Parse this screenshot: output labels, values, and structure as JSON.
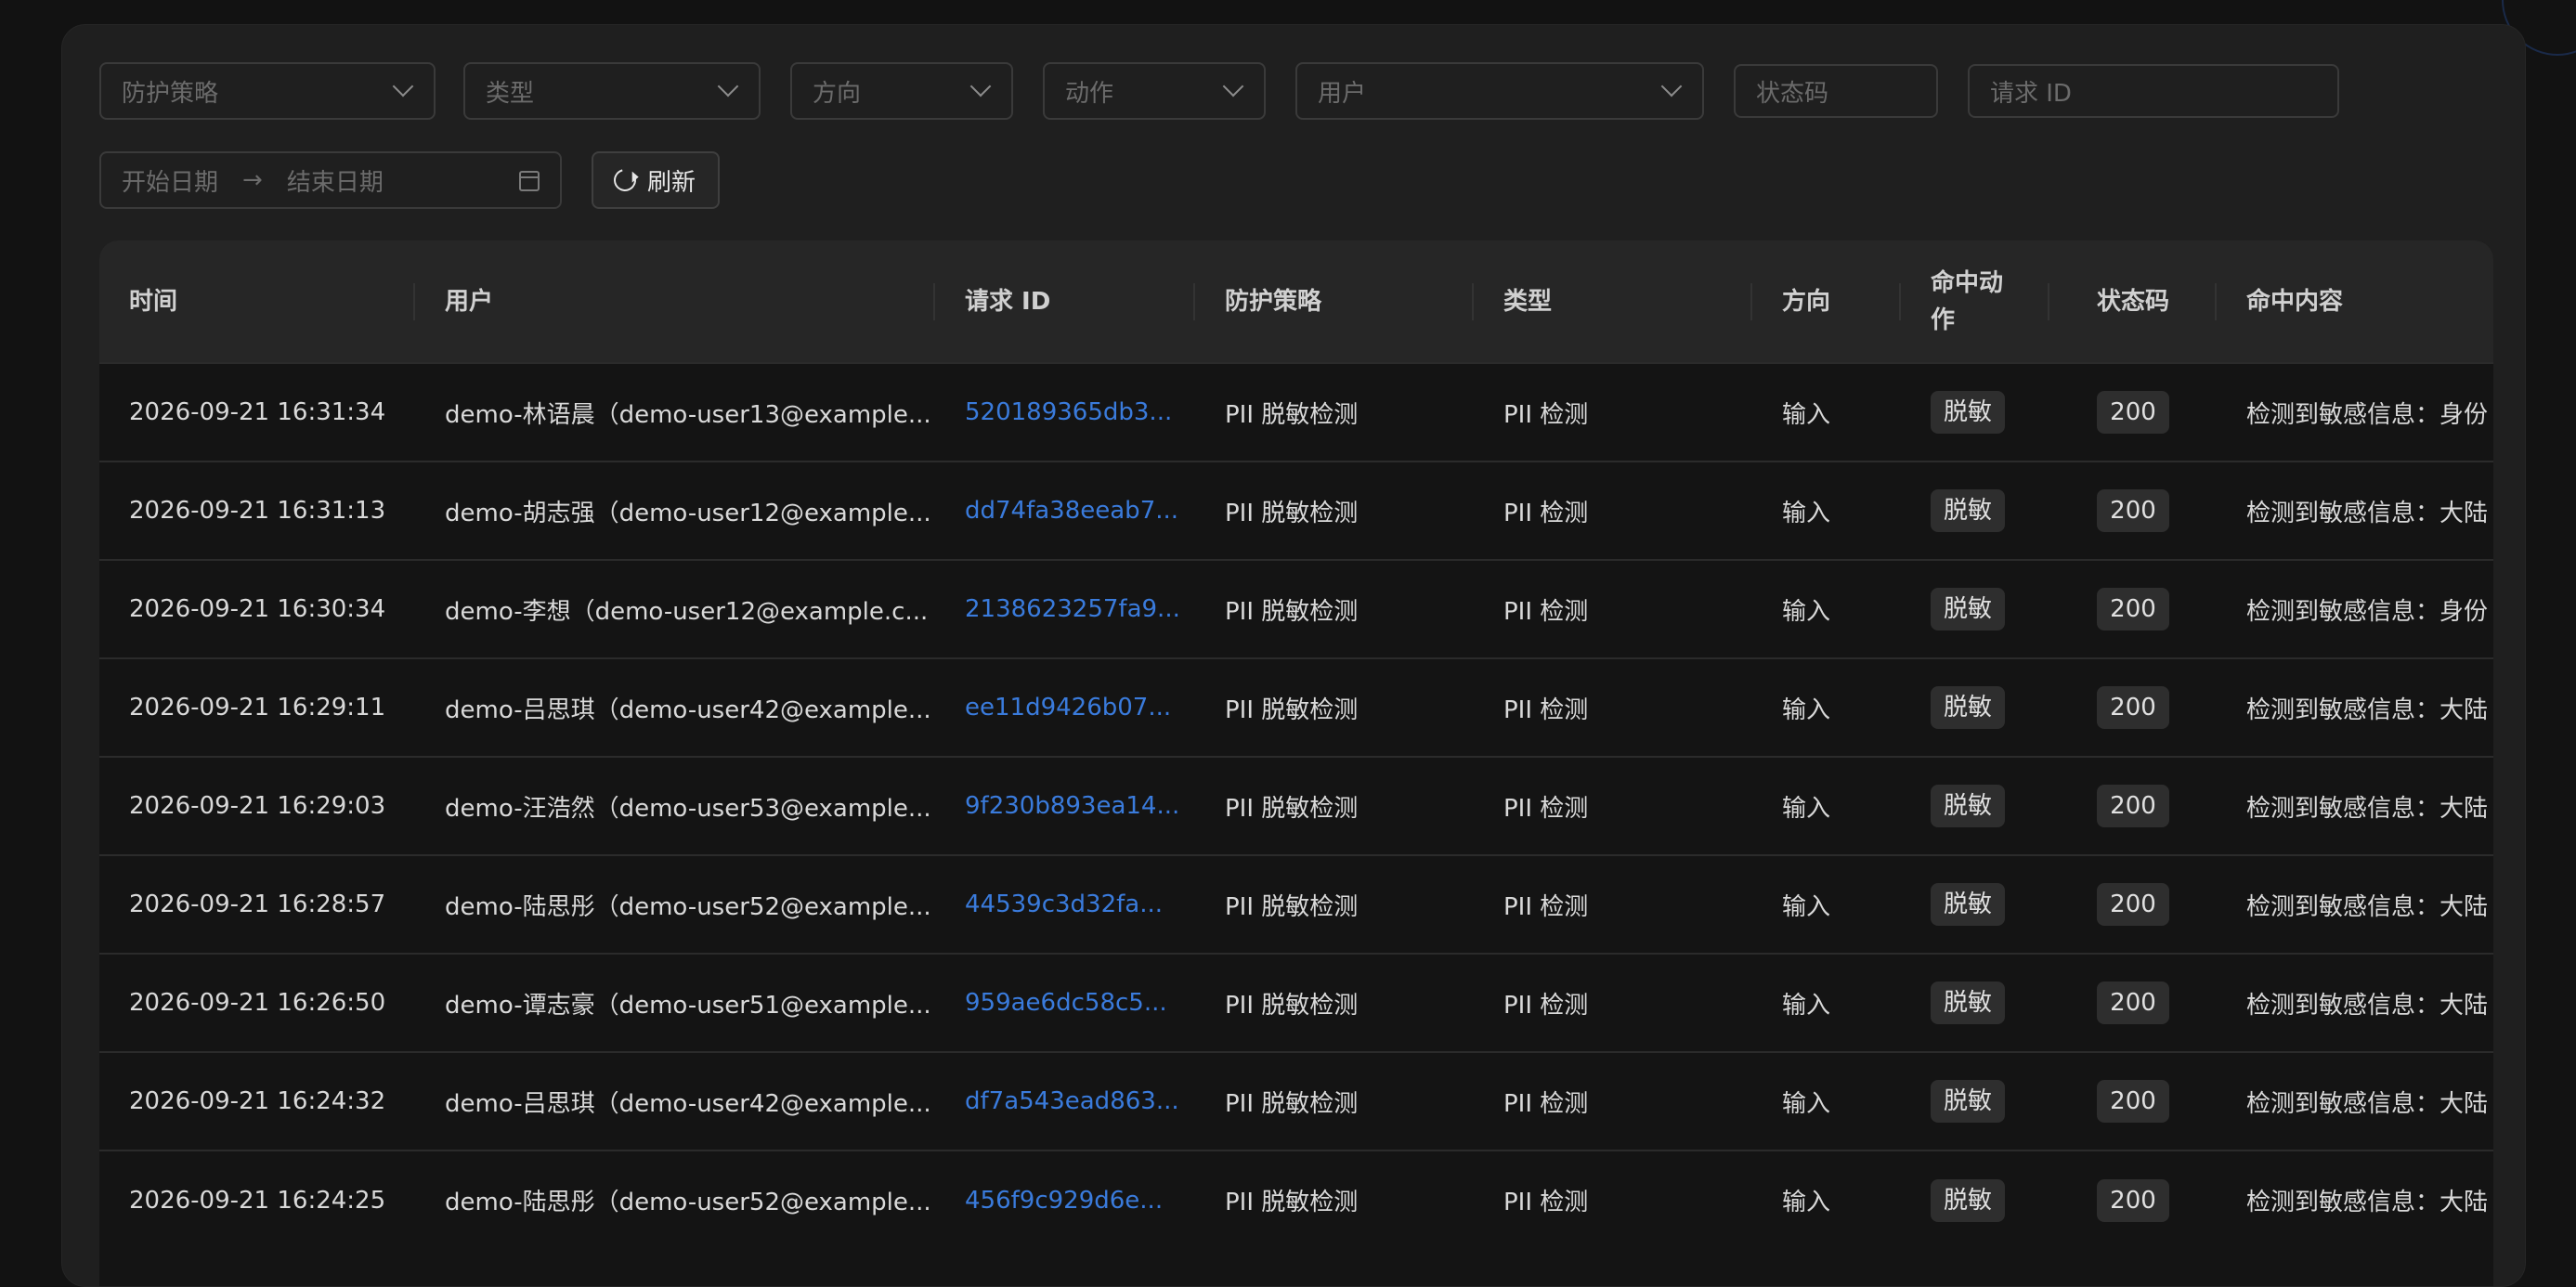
{
  "filters": {
    "policy": "防护策略",
    "type": "类型",
    "direction": "方向",
    "action": "动作",
    "user": "用户",
    "status_code": "状态码",
    "request_id": "请求 ID",
    "start_date": "开始日期",
    "end_date": "结束日期",
    "refresh": "刷新"
  },
  "table": {
    "headers": [
      "时间",
      "用户",
      "请求 ID",
      "防护策略",
      "类型",
      "方向",
      "命中动作",
      "状态码",
      "命中内容"
    ],
    "rows": [
      {
        "time": "2026-09-21 16:31:34",
        "user": "demo-林语晨（demo-user13@example...",
        "req": "520189365db3...",
        "policy": "PII 脱敏检测",
        "type": "PII 检测",
        "dir": "输入",
        "action": "脱敏",
        "code": "200",
        "content": "检测到敏感信息：身份"
      },
      {
        "time": "2026-09-21 16:31:13",
        "user": "demo-胡志强（demo-user12@example...",
        "req": "dd74fa38eeab7...",
        "policy": "PII 脱敏检测",
        "type": "PII 检测",
        "dir": "输入",
        "action": "脱敏",
        "code": "200",
        "content": "检测到敏感信息：大陆"
      },
      {
        "time": "2026-09-21 16:30:34",
        "user": "demo-李想（demo-user12@example.c...",
        "req": "2138623257fa9...",
        "policy": "PII 脱敏检测",
        "type": "PII 检测",
        "dir": "输入",
        "action": "脱敏",
        "code": "200",
        "content": "检测到敏感信息：身份"
      },
      {
        "time": "2026-09-21 16:29:11",
        "user": "demo-吕思琪（demo-user42@example...",
        "req": "ee11d9426b07...",
        "policy": "PII 脱敏检测",
        "type": "PII 检测",
        "dir": "输入",
        "action": "脱敏",
        "code": "200",
        "content": "检测到敏感信息：大陆"
      },
      {
        "time": "2026-09-21 16:29:03",
        "user": "demo-汪浩然（demo-user53@example...",
        "req": "9f230b893ea14...",
        "policy": "PII 脱敏检测",
        "type": "PII 检测",
        "dir": "输入",
        "action": "脱敏",
        "code": "200",
        "content": "检测到敏感信息：大陆"
      },
      {
        "time": "2026-09-21 16:28:57",
        "user": "demo-陆思彤（demo-user52@example...",
        "req": "44539c3d32fa...",
        "policy": "PII 脱敏检测",
        "type": "PII 检测",
        "dir": "输入",
        "action": "脱敏",
        "code": "200",
        "content": "检测到敏感信息：大陆"
      },
      {
        "time": "2026-09-21 16:26:50",
        "user": "demo-谭志豪（demo-user51@example...",
        "req": "959ae6dc58c5...",
        "policy": "PII 脱敏检测",
        "type": "PII 检测",
        "dir": "输入",
        "action": "脱敏",
        "code": "200",
        "content": "检测到敏感信息：大陆"
      },
      {
        "time": "2026-09-21 16:24:32",
        "user": "demo-吕思琪（demo-user42@example...",
        "req": "df7a543ead863...",
        "policy": "PII 脱敏检测",
        "type": "PII 检测",
        "dir": "输入",
        "action": "脱敏",
        "code": "200",
        "content": "检测到敏感信息：大陆"
      },
      {
        "time": "2026-09-21 16:24:25",
        "user": "demo-陆思彤（demo-user52@example...",
        "req": "456f9c929d6e...",
        "policy": "PII 脱敏检测",
        "type": "PII 检测",
        "dir": "输入",
        "action": "脱敏",
        "code": "200",
        "content": "检测到敏感信息：大陆"
      }
    ]
  },
  "colors": {
    "link": "#3a7bdc",
    "panel_bg": "#1f1f1f",
    "table_bg": "#141414"
  }
}
